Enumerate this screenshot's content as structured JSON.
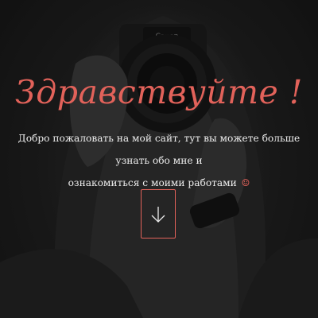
{
  "hero": {
    "title": "Здравствуйте !",
    "subtitle_line1": "Добро пожаловать на мой сайт, тут вы можете больше узнать обо мне и",
    "subtitle_line2": "ознакомиться с моими работами",
    "smile_glyph": "☺"
  },
  "colors": {
    "accent": "#e2625a",
    "text": "#ededed",
    "background": "#1c1c1c"
  },
  "icons": {
    "scroll_down": "arrow-down-icon",
    "smile": "smile-icon"
  }
}
